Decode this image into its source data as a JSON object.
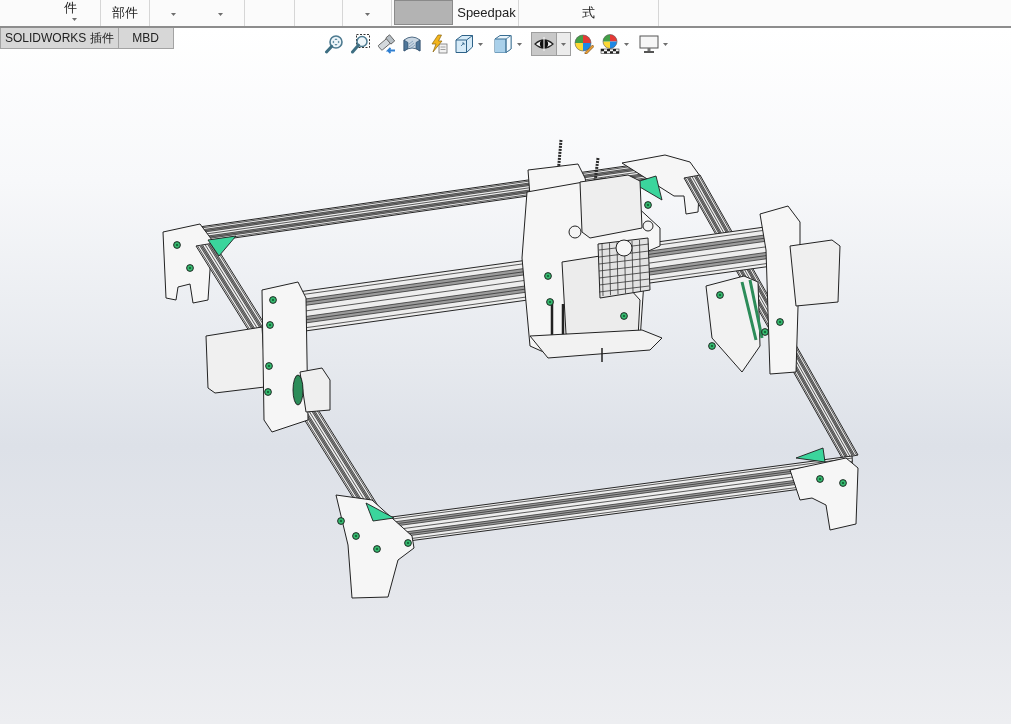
{
  "ribbon": {
    "buttons": [
      {
        "kind": "text",
        "label": "件",
        "caret": true
      },
      {
        "kind": "text",
        "label": "部件",
        "caret": false
      },
      {
        "kind": "pair"
      },
      {
        "kind": "blank"
      },
      {
        "kind": "blank"
      },
      {
        "kind": "dropdown"
      },
      {
        "kind": "tile"
      },
      {
        "kind": "text",
        "label": "Speedpak",
        "caret": false
      },
      {
        "kind": "text",
        "label": "式",
        "caret": false
      }
    ]
  },
  "tabs": [
    {
      "label": "SOLIDWORKS 插件",
      "selected": false
    },
    {
      "label": "MBD",
      "selected": false
    }
  ],
  "view_toolbar": {
    "items": [
      {
        "kind": "magnifier",
        "dropdown": false,
        "selected": false
      },
      {
        "kind": "zoombox",
        "dropdown": false,
        "selected": false
      },
      {
        "kind": "spyglass",
        "dropdown": false,
        "selected": false
      },
      {
        "kind": "section",
        "dropdown": false,
        "selected": false
      },
      {
        "kind": "annotation",
        "dropdown": false,
        "selected": false
      },
      {
        "kind": "cube",
        "dropdown": true,
        "selected": false
      },
      {
        "kind": "shaded",
        "dropdown": true,
        "selected": false
      },
      {
        "kind": "eye",
        "dropdown": true,
        "selected": true
      },
      {
        "kind": "palette",
        "dropdown": false,
        "selected": false
      },
      {
        "kind": "scene",
        "dropdown": true,
        "selected": false
      },
      {
        "kind": "monitor",
        "dropdown": true,
        "selected": false
      }
    ]
  }
}
